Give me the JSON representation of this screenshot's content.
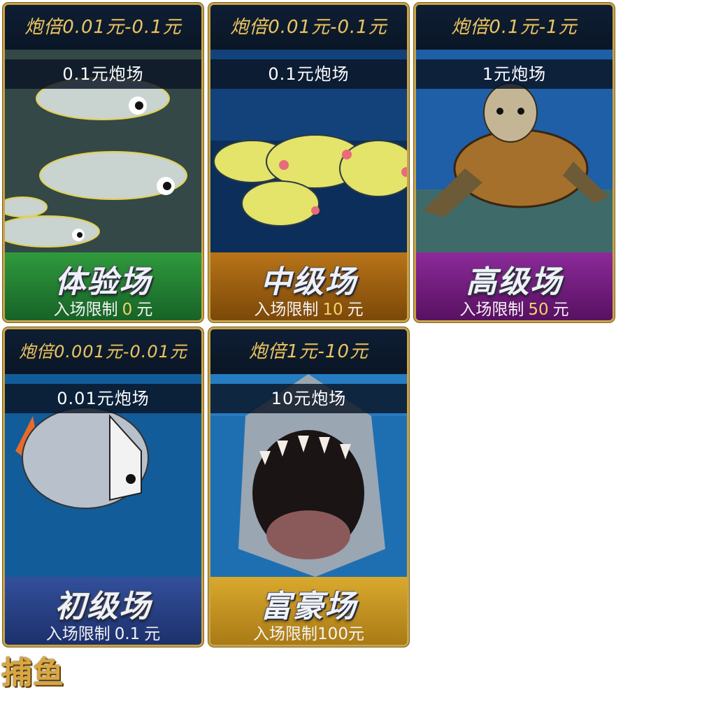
{
  "title": "捕鱼",
  "rooms": [
    {
      "rate": "炮倍0.01元-0.1元",
      "room": "0.1元炮场",
      "level": "体验场",
      "entry_label": "入场限制",
      "entry_value": "0",
      "entry_unit": "元",
      "theme_color": "#1f7a2e"
    },
    {
      "rate": "炮倍0.01元-0.1元",
      "room": "0.1元炮场",
      "level": "中级场",
      "entry_label": "入场限制",
      "entry_value": "10",
      "entry_unit": "元",
      "theme_color": "#9a5c10"
    },
    {
      "rate": "炮倍0.1元-1元",
      "room": "1元炮场",
      "level": "高级场",
      "entry_label": "入场限制",
      "entry_value": "50",
      "entry_unit": "元",
      "theme_color": "#6e1a78"
    },
    {
      "rate": "炮倍0.001元-0.01元",
      "room": "0.01元炮场",
      "level": "初级场",
      "entry_label": "入场限制",
      "entry_value": "0.1",
      "entry_unit": "元",
      "theme_color": "#263f86"
    },
    {
      "rate": "炮倍1元-10元",
      "room": "10元炮场",
      "level": "富豪场",
      "entry_label": "入场限制",
      "entry_value": "100",
      "entry_unit": "元",
      "theme_color": "#c99a22"
    }
  ]
}
